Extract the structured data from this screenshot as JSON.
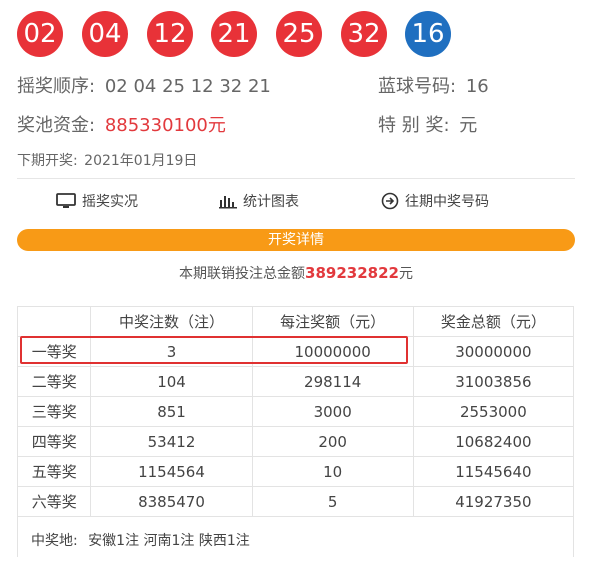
{
  "balls": {
    "red": [
      "02",
      "04",
      "12",
      "21",
      "25",
      "32"
    ],
    "blue": "16"
  },
  "draw_order": {
    "label": "摇奖顺序:",
    "value": "02 04 25 12 32 21"
  },
  "blue_ball": {
    "label": "蓝球号码:",
    "value": "16"
  },
  "pool": {
    "label": "奖池资金:",
    "amount": "885330100",
    "unit": "元"
  },
  "special_prize": {
    "label": "特 别 奖:",
    "value": "元"
  },
  "next_draw": {
    "label": "下期开奖:",
    "date": "2021年01月19日"
  },
  "nav": {
    "live": "摇奖实况",
    "charts": "统计图表",
    "history": "往期中奖号码"
  },
  "details_button": "开奖详情",
  "sales": {
    "label": "本期联销投注总金额",
    "amount": "389232822",
    "unit": "元"
  },
  "table": {
    "headers": [
      "",
      "中奖注数（注）",
      "每注奖额（元）",
      "奖金总额（元）"
    ],
    "rows": [
      [
        "一等奖",
        "3",
        "10000000",
        "30000000"
      ],
      [
        "二等奖",
        "104",
        "298114",
        "31003856"
      ],
      [
        "三等奖",
        "851",
        "3000",
        "2553000"
      ],
      [
        "四等奖",
        "53412",
        "200",
        "10682400"
      ],
      [
        "五等奖",
        "1154564",
        "10",
        "11545640"
      ],
      [
        "六等奖",
        "8385470",
        "5",
        "41927350"
      ]
    ]
  },
  "winning_places": {
    "label": "中奖地:",
    "value": "安徽1注 河南1注 陕西1注"
  },
  "colors": {
    "red_ball": "#e83238",
    "blue_ball": "#1f6fc0",
    "accent_orange": "#f89a16",
    "highlight_red": "#e03131"
  }
}
